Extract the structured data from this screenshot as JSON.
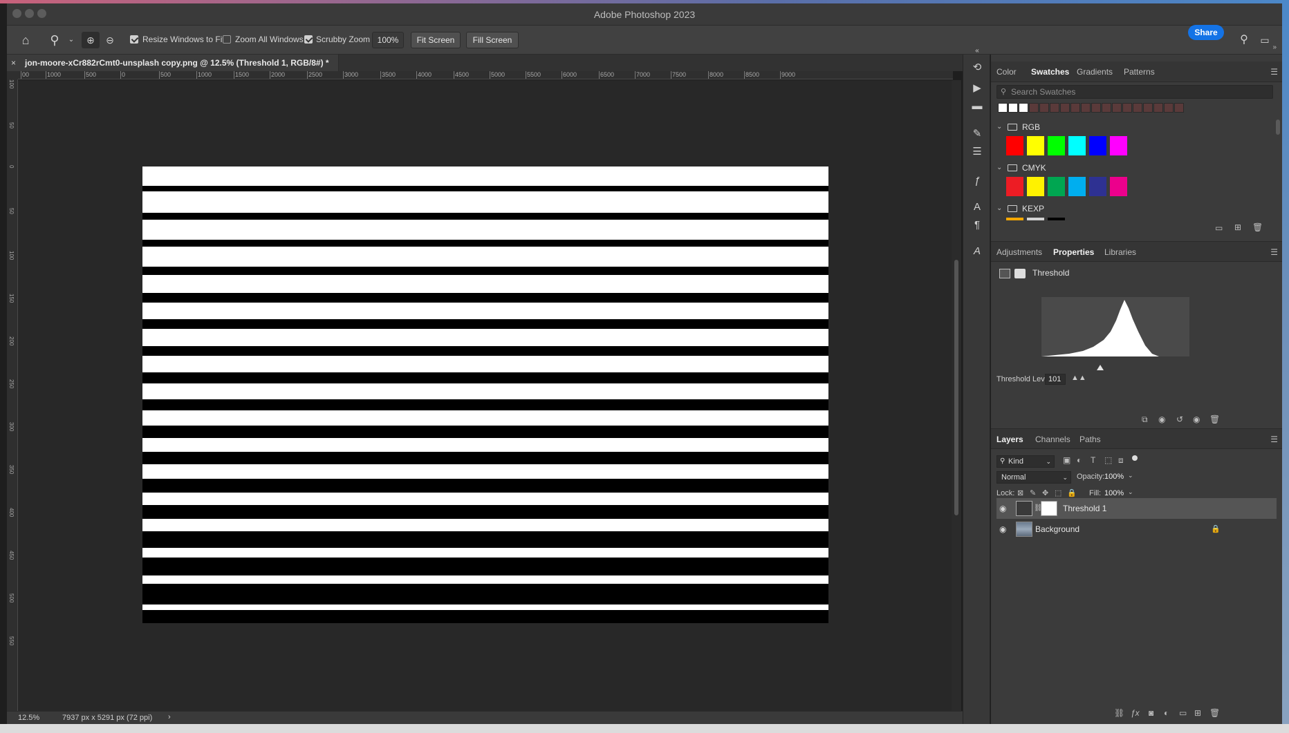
{
  "app": {
    "title": "Adobe Photoshop 2023"
  },
  "options_bar": {
    "resize_windows_label": "Resize Windows to Fit",
    "resize_windows_checked": true,
    "zoom_all_label": "Zoom All Windows",
    "zoom_all_checked": false,
    "scrubby_zoom_label": "Scrubby Zoom",
    "scrubby_zoom_checked": true,
    "zoom_value": "100%",
    "fit_screen_label": "Fit Screen",
    "fill_screen_label": "Fill Screen",
    "share_label": "Share"
  },
  "document": {
    "tab_title": "jon-moore-xCr882rCmt0-unsplash copy.png @ 12.5% (Threshold 1, RGB/8#) *",
    "ruler_h_ticks": [
      "00",
      "1000",
      "500",
      "0",
      "500",
      "1000",
      "1500",
      "2000",
      "2500",
      "3000",
      "3500",
      "4000",
      "4500",
      "5000",
      "5500",
      "6000",
      "6500",
      "7000",
      "7500",
      "8000",
      "8500",
      "9000"
    ],
    "ruler_v_ticks": [
      "100",
      "50",
      "0",
      "50",
      "100",
      "150",
      "200",
      "250",
      "300",
      "350",
      "400",
      "450",
      "500",
      "550"
    ]
  },
  "status": {
    "zoom": "12.5%",
    "doc_size": "7937 px x 5291 px (72 ppi)",
    "arrow": "›"
  },
  "swatches_panel": {
    "tabs": [
      "Color",
      "Swatches",
      "Gradients",
      "Patterns"
    ],
    "active_tab": "Swatches",
    "search_placeholder": "Search Swatches",
    "recent_colors": [
      "#ffffff",
      "#ffffff",
      "#ffffff",
      "#5a3a3a",
      "#5a3a3a",
      "#5a3a3a",
      "#5a3a3a",
      "#5a3a3a",
      "#5a3a3a",
      "#5a3a3a",
      "#5a3a3a",
      "#5a3a3a",
      "#5a3a3a",
      "#5a3a3a",
      "#5a3a3a",
      "#5a3a3a",
      "#5a3a3a",
      "#5a3a3a"
    ],
    "groups": [
      {
        "name": "RGB",
        "colors": [
          "#ff0000",
          "#ffff00",
          "#00ff00",
          "#00ffff",
          "#0000ff",
          "#ff00ff"
        ]
      },
      {
        "name": "CMYK",
        "colors": [
          "#ed1c24",
          "#fff200",
          "#00a651",
          "#00aeef",
          "#2e3192",
          "#ec008c"
        ]
      },
      {
        "name": "KEXP",
        "colors": [
          "#f7a800",
          "#d4d4d4",
          "#000000"
        ]
      }
    ]
  },
  "properties_panel": {
    "tabs": [
      "Adjustments",
      "Properties",
      "Libraries"
    ],
    "active_tab": "Properties",
    "adjustment_name": "Threshold",
    "threshold_label": "Threshold Level:",
    "threshold_value": "101"
  },
  "layers_panel": {
    "tabs": [
      "Layers",
      "Channels",
      "Paths"
    ],
    "active_tab": "Layers",
    "filter_kind": "Kind",
    "blend_mode": "Normal",
    "opacity_label": "Opacity:",
    "opacity_value": "100%",
    "lock_label": "Lock:",
    "fill_label": "Fill:",
    "fill_value": "100%",
    "layers": [
      {
        "name": "Threshold 1",
        "selected": true,
        "visible": true,
        "locked": false
      },
      {
        "name": "Background",
        "selected": false,
        "visible": true,
        "locked": true
      }
    ]
  },
  "colors": {
    "accent": "#1473e6",
    "canvas_bg": "#282828",
    "panel_bg": "#3b3b3b"
  }
}
